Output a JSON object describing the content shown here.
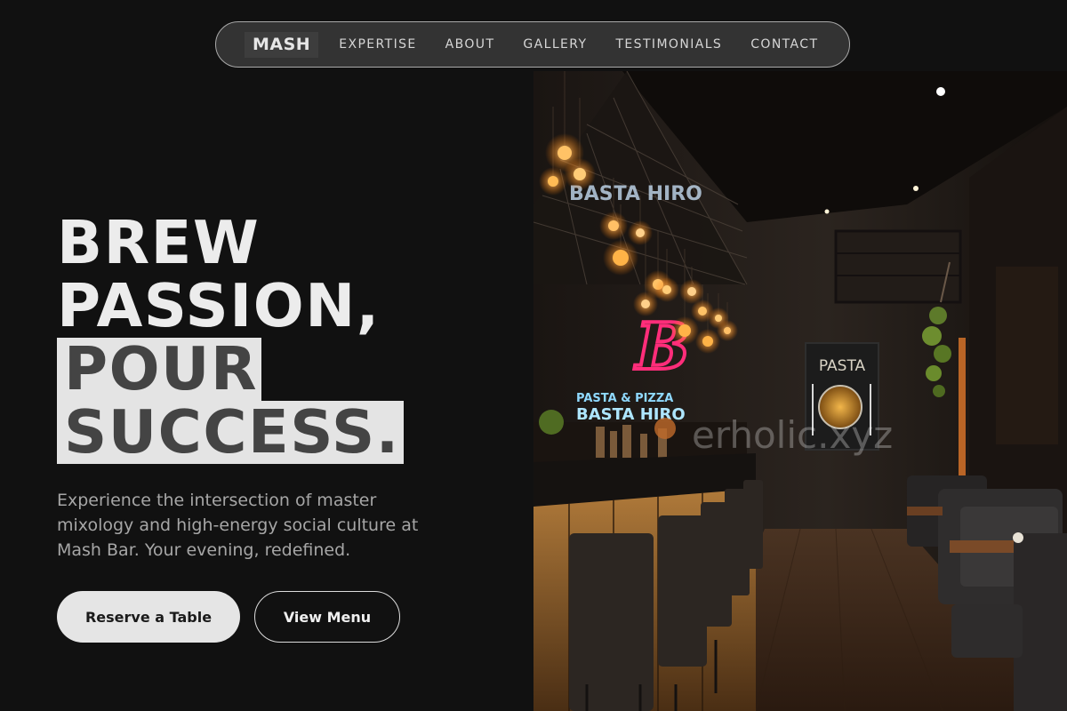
{
  "nav": {
    "brand": "MASH",
    "links": [
      {
        "label": "EXPERTISE"
      },
      {
        "label": "ABOUT"
      },
      {
        "label": "GALLERY"
      },
      {
        "label": "TESTIMONIALS"
      },
      {
        "label": "CONTACT"
      }
    ]
  },
  "hero": {
    "title_line1": "BREW",
    "title_line2": "PASSION,",
    "title_line3": "POUR",
    "title_line4": "SUCCESS.",
    "subtitle": "Experience the intersection of master mixology and high-energy social culture at Mash Bar. Your evening, redefined.",
    "primary_button": "Reserve a Table",
    "secondary_button": "View Menu"
  },
  "photo": {
    "neon_letter": "B",
    "neon_sign_top": "PASTA & PIZZA",
    "neon_sign_main": "BASTA HIRO",
    "poster_title": "PASTA",
    "watermark": "erholic.xyz"
  },
  "colors": {
    "background": "#111111",
    "nav_bg": "#333333",
    "title": "#ececec",
    "highlight_bg": "#e4e4e4",
    "highlight_text": "#444444",
    "neon_pink": "#ff2d7a",
    "neon_blue": "#7fd3ff",
    "bulb": "#ffb347"
  }
}
